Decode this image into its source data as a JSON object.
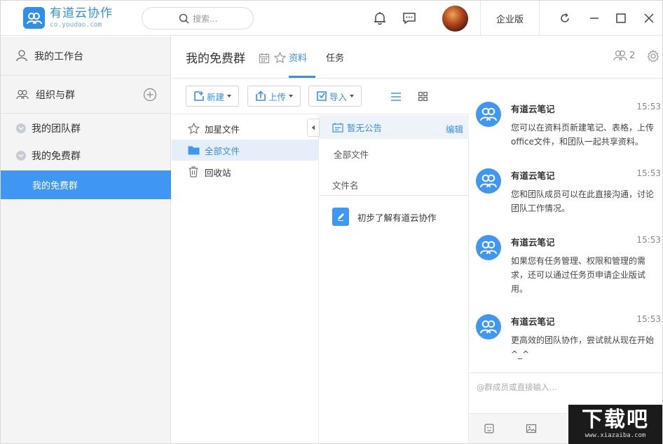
{
  "app": {
    "name": "有道云协作",
    "domain": "co.youdao.com",
    "search_placeholder": "搜索...",
    "enterprise_label": "企业版"
  },
  "sidebar": {
    "workspace": "我的工作台",
    "org_groups": "组织与群",
    "items": [
      {
        "label": "我的团队群"
      },
      {
        "label": "我的免费群"
      },
      {
        "label": "我的免费群"
      }
    ]
  },
  "header": {
    "title": "我的免费群",
    "tabs": [
      {
        "label": "资料"
      },
      {
        "label": "任务"
      }
    ],
    "member_count": "2"
  },
  "toolbar": {
    "new_label": "新建",
    "upload_label": "上传",
    "import_label": "导入"
  },
  "folders": [
    {
      "label": "加星文件",
      "icon": "star-icon"
    },
    {
      "label": "全部文件",
      "icon": "folder-icon"
    },
    {
      "label": "回收站",
      "icon": "trash-icon"
    }
  ],
  "files": {
    "notice": "暂无公告",
    "edit_label": "编辑",
    "breadcrumb": "全部文件",
    "column_header": "文件名",
    "rows": [
      {
        "name": "初步了解有道云协作"
      }
    ]
  },
  "chat": {
    "messages": [
      {
        "sender": "有道云笔记",
        "time": "15:53",
        "text": "您可以在资料页新建笔记、表格，上传office文件，和团队一起共享资料。"
      },
      {
        "sender": "有道云笔记",
        "time": "15:53",
        "text": "您和团队成员可以在此直接沟通，讨论团队工作情况。"
      },
      {
        "sender": "有道云笔记",
        "time": "15:53",
        "text": "如果您有任务管理、权限和管理的需求，还可以通过任务页申请企业版试用。"
      },
      {
        "sender": "有道云笔记",
        "time": "15:53",
        "text": "更高效的团队协作，尝试就从现在开始^_^"
      }
    ],
    "input_placeholder": "@群成员或直接输入…"
  },
  "watermark": {
    "big": "下载吧",
    "small": "www.xiazaiba.com"
  },
  "colors": {
    "accent": "#3f96f3",
    "link": "#3a8ee6"
  }
}
